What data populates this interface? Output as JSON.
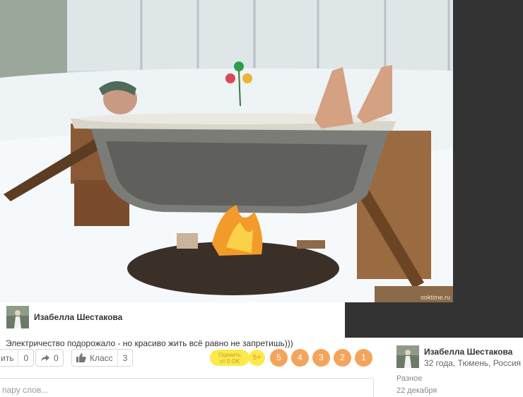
{
  "photo": {
    "watermark": "ooktime.ru"
  },
  "post": {
    "author_name": "Изабелла Шестакова",
    "caption": "Электричество подорожало - но красиво жить всё равно не запретишь)))"
  },
  "actions": {
    "share_label": "ить",
    "share_count": "0",
    "reshare_count": "0",
    "like_label": "Класс",
    "like_count": "3"
  },
  "rating": {
    "label_line1": "Оценить",
    "label_line2": "от 0 OK",
    "five_plus": "5+",
    "values": [
      "5",
      "4",
      "3",
      "2",
      "1"
    ]
  },
  "comment": {
    "placeholder": "пару слов..."
  },
  "sidebar": {
    "author_name": "Изабелла Шестакова",
    "author_meta": "32 года, Тюмень, Россия",
    "category": "Разное",
    "date": "22 декабря"
  },
  "colors": {
    "rating_orange": "#f5a45c",
    "rating_yellow": "#fde94a"
  }
}
